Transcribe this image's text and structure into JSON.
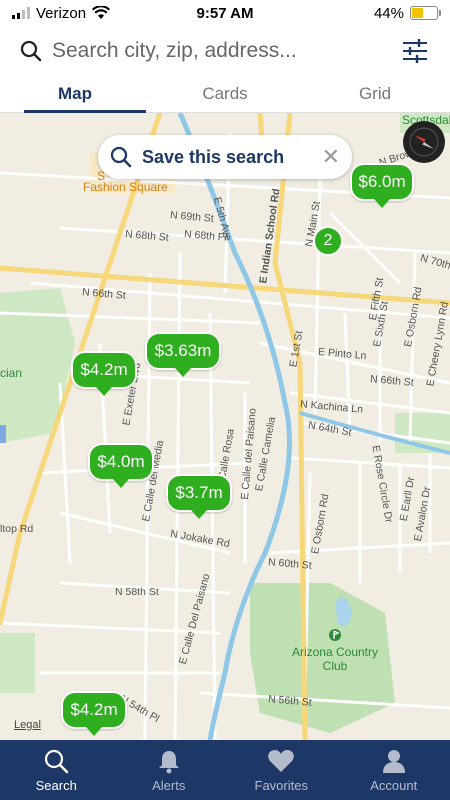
{
  "status_bar": {
    "carrier": "Verizon",
    "time": "9:57 AM",
    "battery": "44%",
    "battery_level": 0.44
  },
  "search": {
    "placeholder": "Search city, zip, address..."
  },
  "tabs": [
    {
      "label": "Map",
      "active": true
    },
    {
      "label": "Cards",
      "active": false
    },
    {
      "label": "Grid",
      "active": false
    }
  ],
  "map": {
    "save_search_label": "Save this search",
    "legal": "Legal",
    "pois": {
      "fashion_square": "Fashion Square",
      "fashion_prefix": "S",
      "scottsdale": "Scottsdale",
      "country_club": "Arizona Country Club",
      "park_partial": "cian"
    },
    "streets": {
      "n_brown_ave": "N Brown Ave",
      "n_69th_st": "N 69th St",
      "n_68th_pl": "N 68th Pl",
      "n_68th_st": "N 68th St",
      "n_66th_st": "N 66th St",
      "n_70th": "N 70th",
      "n_main_st": "N Main St",
      "e_indian_school_rd": "E Indian School Rd",
      "e_5th_ave": "E 5th Ave",
      "e_1st_st": "E 1st St",
      "e_pinto_ln": "E Pinto Ln",
      "e_fifth_st": "E Fifth St",
      "e_sixth_st": "E Sixth St",
      "e_osborn_rd_1": "E Osborn Rd",
      "e_cheery_lynn": "E Cheery Lynn Rd",
      "n_66th_st_e": "N 66th St",
      "n_kachina_ln": "N Kachina Ln",
      "n_64th_st": "N 64th St",
      "e_exeter": "E Exeter Blvd",
      "e_calle_del_media": "E Calle del Media",
      "e_calle_del_paisano": "E Calle del Paisano",
      "e_calle_rosa": "E Calle Rosa",
      "e_calle_camelia": "E Calle Camelia",
      "e_rose_circle": "E Rose Circle Dr",
      "e_earll_dr": "E Earll Dr",
      "e_avalon_dr": "E Avalon Dr",
      "e_osborn_rd_2": "E Osborn Rd",
      "n_jokake_rd": "N Jokake Rd",
      "n_60th_st": "N 60th St",
      "n_58th_st": "N 58th St",
      "n_56th_st": "N 56th St",
      "n_54th_pl": "N 54th Pl",
      "e_calle_del_paisano_2": "E Calle Del Paisano",
      "ltop_rd": "ltop Rd"
    },
    "pins": [
      {
        "price": "$6.0m"
      },
      {
        "price": "$3.63m"
      },
      {
        "price": "$4.2m"
      },
      {
        "price": "$4.0m"
      },
      {
        "price": "$3.7m"
      },
      {
        "price": "$4.2m"
      }
    ],
    "cluster_count": "2"
  },
  "bottom_nav": [
    {
      "label": "Search",
      "icon": "search-icon",
      "active": true
    },
    {
      "label": "Alerts",
      "icon": "bell-icon",
      "active": false
    },
    {
      "label": "Favorites",
      "icon": "heart-icon",
      "active": false
    },
    {
      "label": "Account",
      "icon": "person-icon",
      "active": false
    }
  ],
  "colors": {
    "brand_navy": "#1d3766",
    "pin_green": "#2fae1f",
    "map_bg": "#f1ede2"
  }
}
